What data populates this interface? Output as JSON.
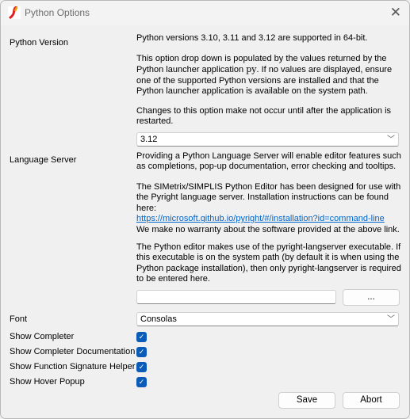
{
  "window": {
    "title": "Python Options",
    "close_icon": "close-icon",
    "accent": "#0b5cb8"
  },
  "python_version": {
    "label": "Python Version",
    "p1": "Python versions 3.10, 3.11 and 3.12 are supported in 64-bit.",
    "p2a": "This option drop down is populated by the values returned by the Python launcher application ",
    "p2code": "py",
    "p2b": ". If no values are displayed, ensure one of the supported Python versions are installed and that the Python launcher application is available on the system path.",
    "p3": "Changes to this option make not occur until after the application is restarted.",
    "selected": "3.12"
  },
  "language_server": {
    "label": "Language Server",
    "p1": "Providing a Python Language Server will enable editor features such as completions, pop-up documentation, error checking and tooltips.",
    "p2": "The SIMetrix/SIMPLIS Python Editor has been designed for use with the Pyright language server. Installation instructions can be found here:",
    "link": "https://microsoft.github.io/pyright/#/installation?id=command-line",
    "p2c": "We make no warranty about the software provided at the above link.",
    "p3": "The Python editor makes use of the pyright-langserver executable. If this executable is on the system path (by default it is when using the Python package installation), then only pyright-langserver is required to be entered here.",
    "path_value": "",
    "browse_label": "..."
  },
  "font": {
    "label": "Font",
    "selected": "Consolas"
  },
  "options": [
    {
      "label": "Show Completer",
      "checked": true
    },
    {
      "label": "Show Completer Documentation",
      "checked": true
    },
    {
      "label": "Show Function Signature Helper",
      "checked": true
    },
    {
      "label": "Show Hover Popup",
      "checked": true
    }
  ],
  "buttons": {
    "save": "Save",
    "abort": "Abort"
  }
}
